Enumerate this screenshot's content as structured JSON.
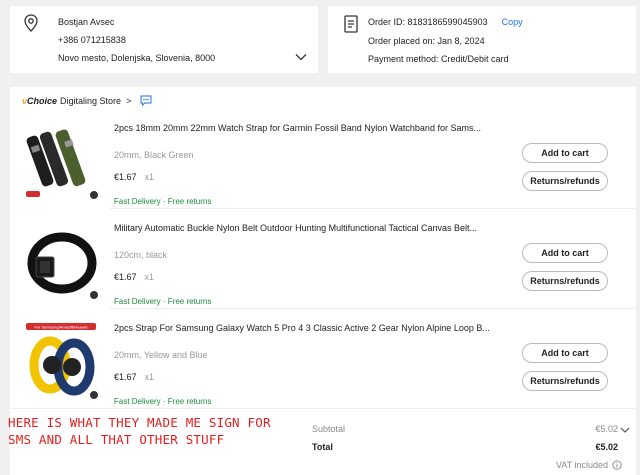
{
  "shipping": {
    "name": "Bostjan Avsec",
    "phone": "+386 071215838",
    "address": "Novo mesto, Dolenjska, Slovenia, 8000"
  },
  "order": {
    "id_label": "Order ID: 8183186599045903",
    "copy_label": "Copy",
    "placed": "Order placed on: Jan 8, 2024",
    "payment": "Payment method: Credit/Debit card"
  },
  "store": {
    "choice_prefix": "v",
    "choice_label": "Choice",
    "name": "Digitaling Store",
    "arrow": ">"
  },
  "items": [
    {
      "title": "2pcs 18mm 20mm 22mm Watch Strap for Garmin Fossil Band Nylon Watchband for Sams...",
      "variant": "20mm, Black Green",
      "price": "€1.67",
      "qty": "x1",
      "delivery": "Fast Delivery · Free returns",
      "add_to_cart": "Add to cart",
      "returns": "Returns/refunds"
    },
    {
      "title": "Military Automatic Buckle Nylon Belt Outdoor Hunting Multifunctional Tactical Canvas Belt...",
      "variant": "120cm, black",
      "price": "€1.67",
      "qty": "x1",
      "delivery": "Fast Delivery · Free returns",
      "add_to_cart": "Add to cart",
      "returns": "Returns/refunds"
    },
    {
      "title": "2pcs Strap For Samsung Galaxy Watch 5 Pro 4 3 Classic Active 2 Gear Nylon Alpine Loop B...",
      "variant": "20mm, Yellow and Blue",
      "price": "€1.67",
      "qty": "x1",
      "delivery": "Fast Delivery · Free returns",
      "add_to_cart": "Add to cart",
      "returns": "Returns/refunds"
    }
  ],
  "thumb_badge": "For Samsung/Amazfit/Huawei",
  "summary": {
    "subtotal_label": "Subtotal",
    "subtotal_value": "€5.02",
    "total_label": "Total",
    "total_value": "€5.02",
    "vat": "VAT included"
  },
  "annotation": {
    "line1": "HERE IS WHAT THEY MADE ME SIGN FOR",
    "line2": "SMS AND ALL THAT OTHER STUFF"
  },
  "colors": {
    "link": "#1a73e8",
    "delivery": "#1f8a3c",
    "annotation": "#e02020",
    "choice_accent": "#f5a623"
  }
}
